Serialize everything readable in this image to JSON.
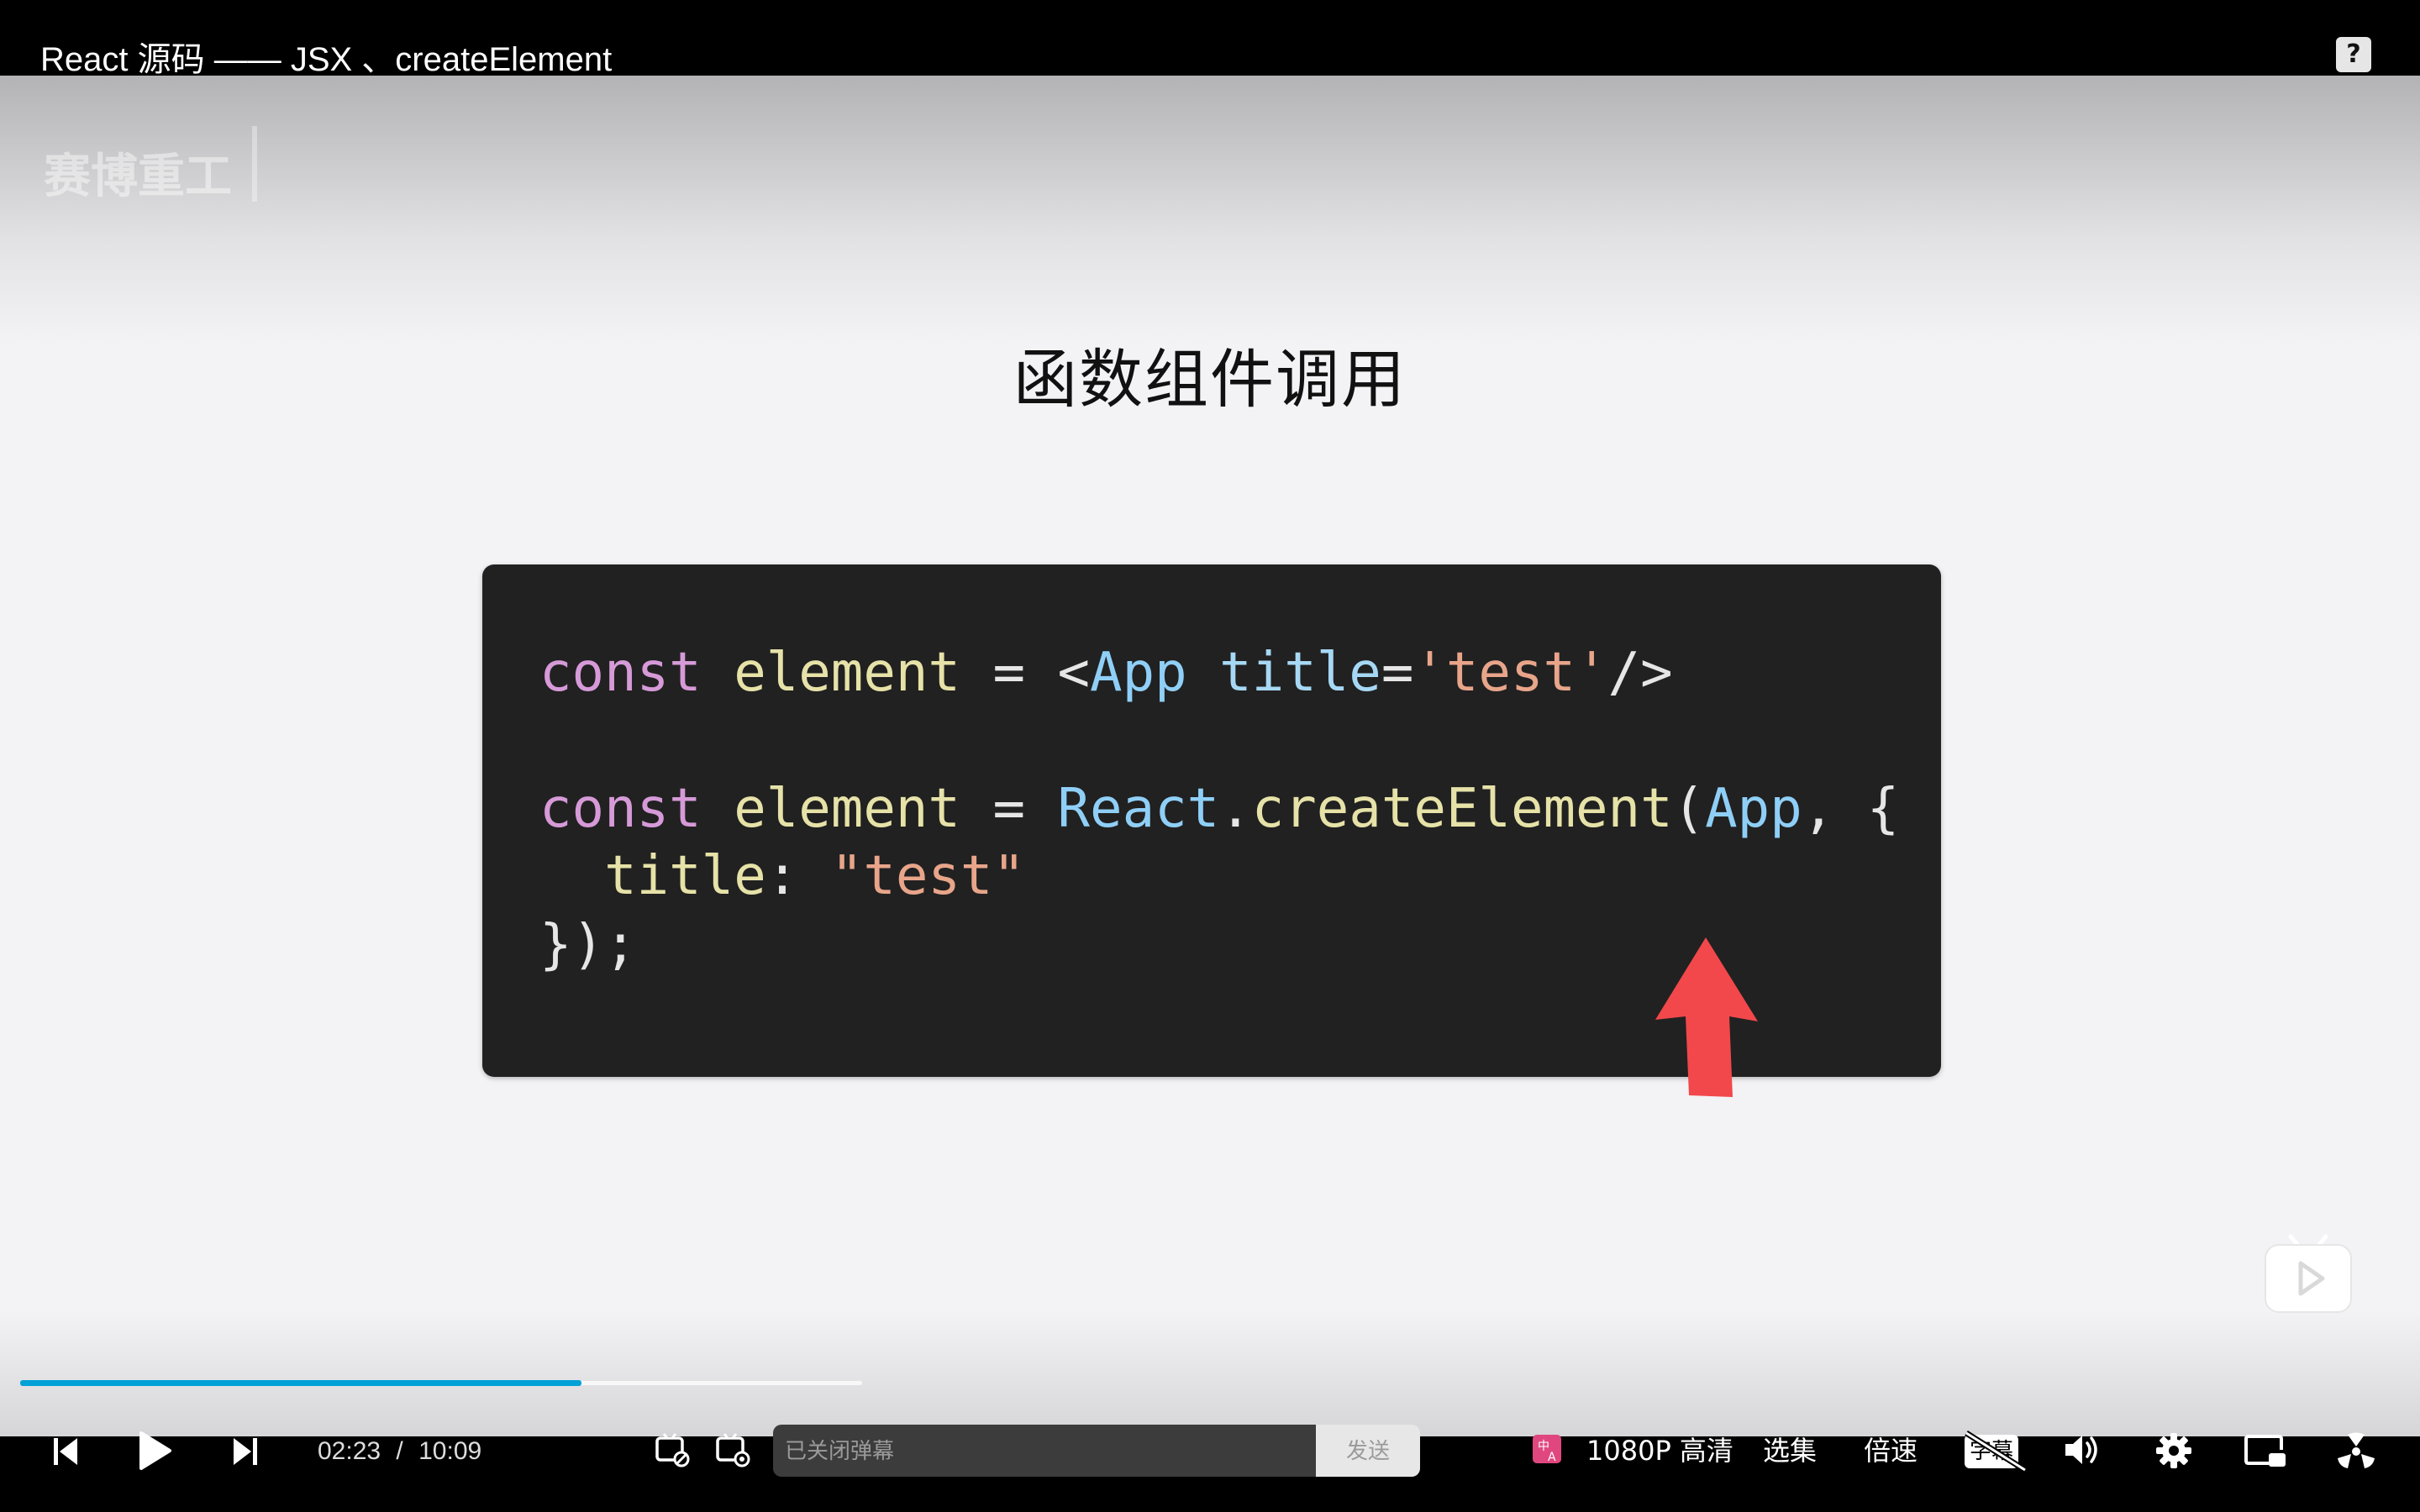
{
  "header": {
    "title": "React 源码 —— JSX 、createElement",
    "help_icon": "question-icon",
    "help_label": "?"
  },
  "slide": {
    "watermark": "赛博重工",
    "title": "函数组件调用",
    "code": {
      "line1": {
        "kw": "const",
        "var": "element",
        "op": "=",
        "lt": "<",
        "tag": "App",
        "attr": "title",
        "eq": "=",
        "str": "'test'",
        "end": "/>"
      },
      "line2": {
        "kw": "const",
        "var": "element",
        "op": "=",
        "obj": "React",
        "dot": ".",
        "fn": "createElement",
        "paren": "(",
        "arg": "App",
        "rest": ", {"
      },
      "line3": {
        "key": "title",
        "colon": ":",
        "str": "\"test\""
      },
      "line4": {
        "text": "});"
      }
    },
    "colors": {
      "keyword": "#d69ad8",
      "string": "#e8a58a",
      "identifier": "#8fcff7",
      "arrow": "#f2484b",
      "code_bg": "#212121"
    }
  },
  "player": {
    "progress_fraction": 0.236,
    "current_time": "02:23",
    "separator": "/",
    "duration": "10:09",
    "danmaku_placeholder": "已关闭弹幕",
    "send_label": "发送",
    "quality_label": "1080P 高清",
    "episodes_label": "选集",
    "speed_label": "倍速",
    "subtitle_icon_label": "字幕",
    "accent_color": "#00a1d6"
  }
}
